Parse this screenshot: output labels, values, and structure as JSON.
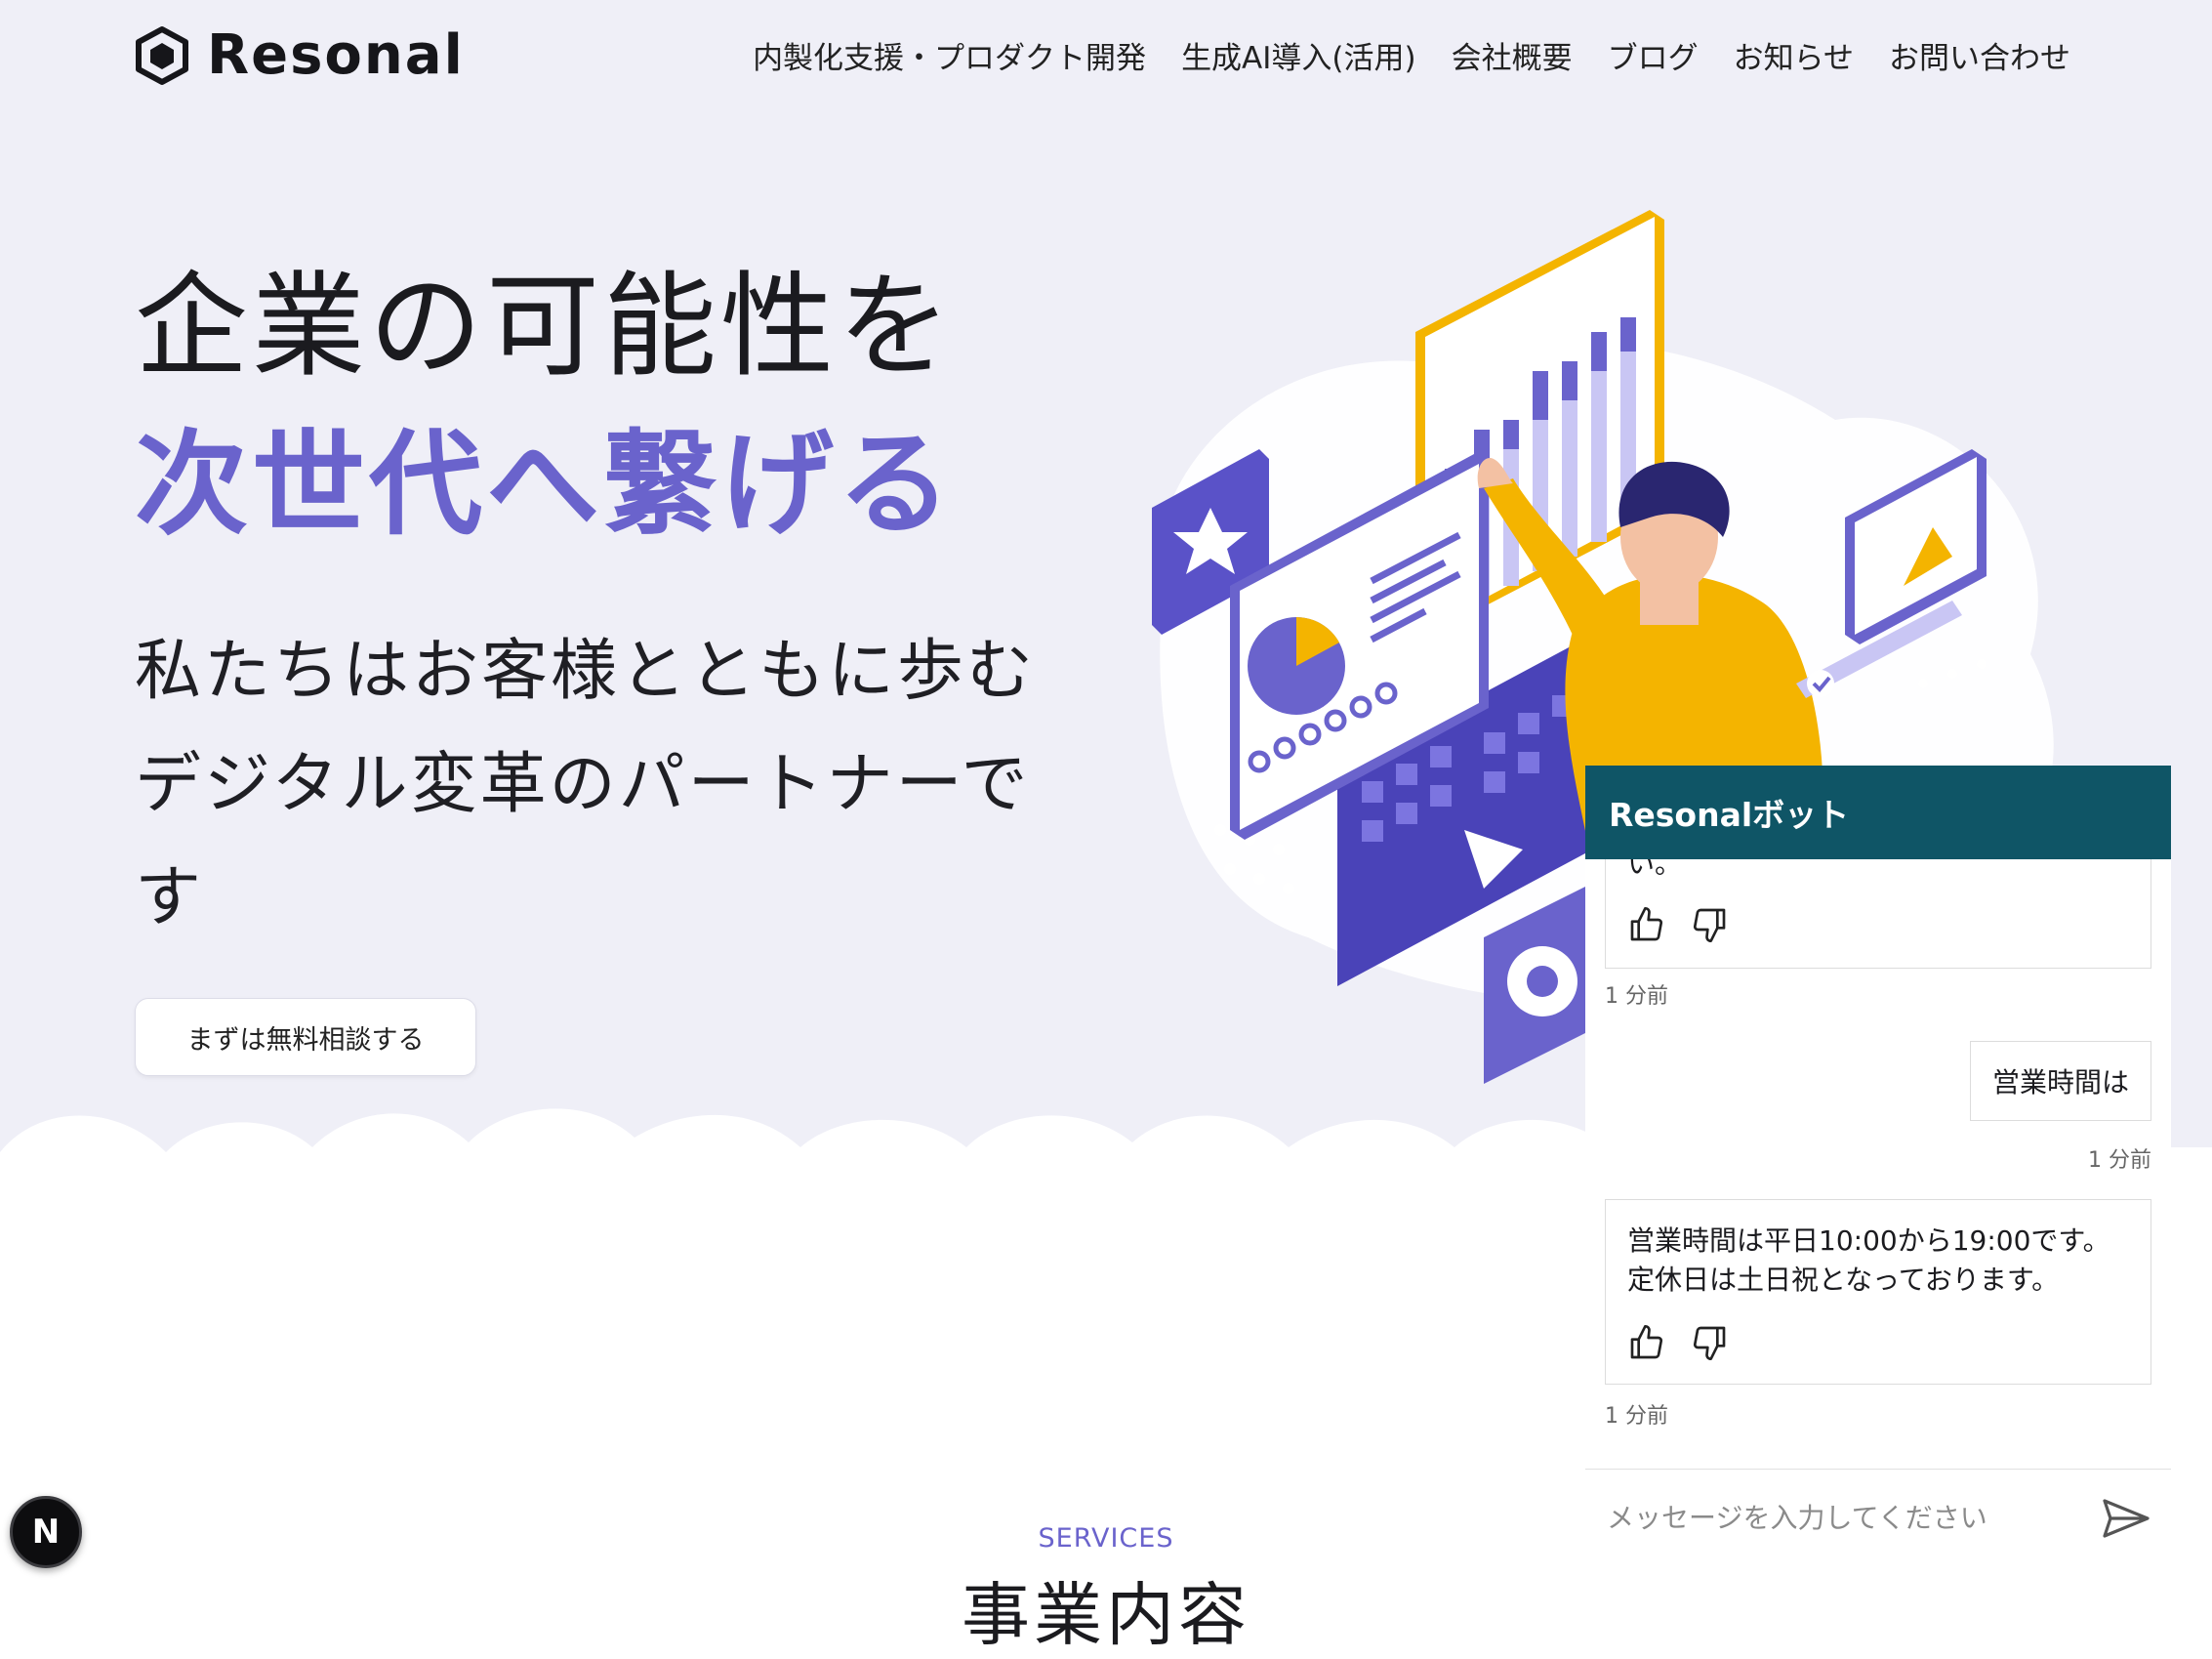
{
  "header": {
    "brand": "Resonal",
    "nav": [
      "内製化支援・プロダクト開発",
      "生成AI導入(活用)",
      "会社概要",
      "ブログ",
      "お知らせ",
      "お問い合わせ"
    ]
  },
  "hero": {
    "title_line1": "企業の可能性を",
    "title_line2": "次世代へ繋げる",
    "subtitle": "私たちはお客様とともに歩むデジタル変革のパートナーです",
    "cta_label": "まずは無料相談する"
  },
  "section": {
    "eyebrow": "SERVICES",
    "title": "事業内容"
  },
  "chat": {
    "title": "Resonalボット",
    "messages": [
      {
        "role": "bot",
        "text": "い。",
        "time": "1 分前"
      },
      {
        "role": "user",
        "text": "営業時間は",
        "time": "1 分前"
      },
      {
        "role": "bot",
        "text": "営業時間は平日10:00から19:00です。定休日は土日祝となっております。",
        "time": "1 分前"
      }
    ],
    "input_placeholder": "メッセージを入力してください"
  },
  "badge": {
    "letter": "N"
  },
  "colors": {
    "accent": "#6a63cc",
    "chat_header": "#0f5566",
    "hero_bg": "#efeff7",
    "illustration_orange": "#f4b400"
  }
}
